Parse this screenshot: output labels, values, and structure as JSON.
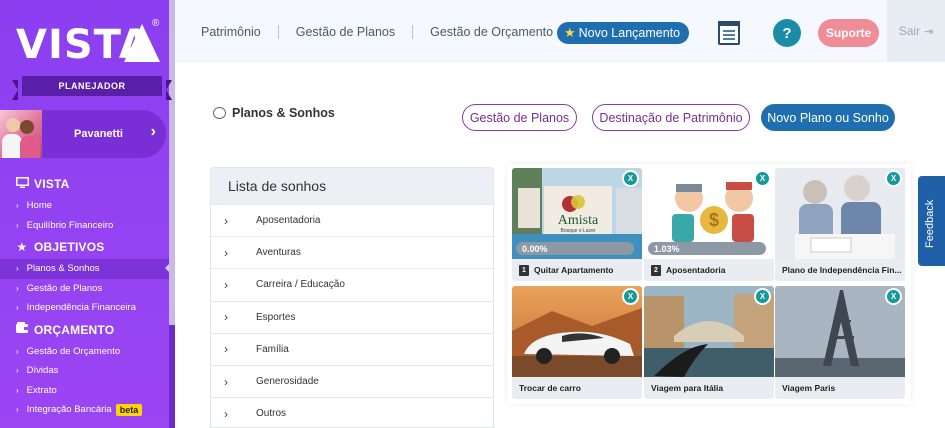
{
  "brand": {
    "logo": "VISTA",
    "reg": "®",
    "subtitle": "PLANEJADOR"
  },
  "user": {
    "name": "Pavanetti"
  },
  "sidebar": {
    "sections": [
      {
        "title": "VISTA",
        "icon": "monitor-icon",
        "items": [
          {
            "label": "Home"
          },
          {
            "label": "Equilíbrio Financeiro"
          }
        ]
      },
      {
        "title": "OBJETIVOS",
        "icon": "star-icon",
        "items": [
          {
            "label": "Planos & Sonhos",
            "active": true
          },
          {
            "label": "Gestão de Planos"
          },
          {
            "label": "Independência Financeira"
          }
        ]
      },
      {
        "title": "ORÇAMENTO",
        "icon": "wallet-icon",
        "items": [
          {
            "label": "Gestão de Orçamento"
          },
          {
            "label": "Dívidas"
          },
          {
            "label": "Extrato"
          },
          {
            "label": "Integração Bancária",
            "badge": "beta"
          }
        ]
      }
    ]
  },
  "topbar": {
    "nav": [
      "Patrimônio",
      "Gestão de Planos",
      "Gestão de Orçamento"
    ],
    "launch": "Novo Lançamento",
    "help": "?",
    "support": "Suporte",
    "logout": "Sair"
  },
  "page": {
    "title": "Planos & Sonhos",
    "buttons": [
      "Gestão de Planos",
      "Destinação de Patrimônio",
      "Novo Plano ou Sonho"
    ]
  },
  "dream_list": {
    "header": "Lista de sonhos",
    "items": [
      "Aposentadoria",
      "Aventuras",
      "Carreira / Educação",
      "Esportes",
      "Família",
      "Generosidade",
      "Outros"
    ]
  },
  "cards": [
    {
      "title": "Quitar Apartamento",
      "num": "1",
      "progress": "0.00%",
      "image": "apartment-photo",
      "brand_text": "Amista",
      "brand_sub": "Bosque e Lazer"
    },
    {
      "title": "Aposentadoria",
      "num": "2",
      "progress": "1.03%",
      "image": "retirement-illustration",
      "coin_text": "$"
    },
    {
      "title": "Plano de Independência Fin...",
      "image": "couple-paperwork-photo"
    },
    {
      "title": "Trocar de carro",
      "image": "white-car-photo"
    },
    {
      "title": "Viagem para Itália",
      "image": "venice-canal-photo"
    },
    {
      "title": "Viagem Paris",
      "image": "eiffel-tower-photo"
    }
  ],
  "close_label": "X",
  "feedback": "Feedback",
  "colors": {
    "sidebar": "#9b45f3",
    "primary": "#1f6fb0",
    "accent": "#159a9c",
    "support": "#ef8c96",
    "beta": "#ffd400"
  }
}
